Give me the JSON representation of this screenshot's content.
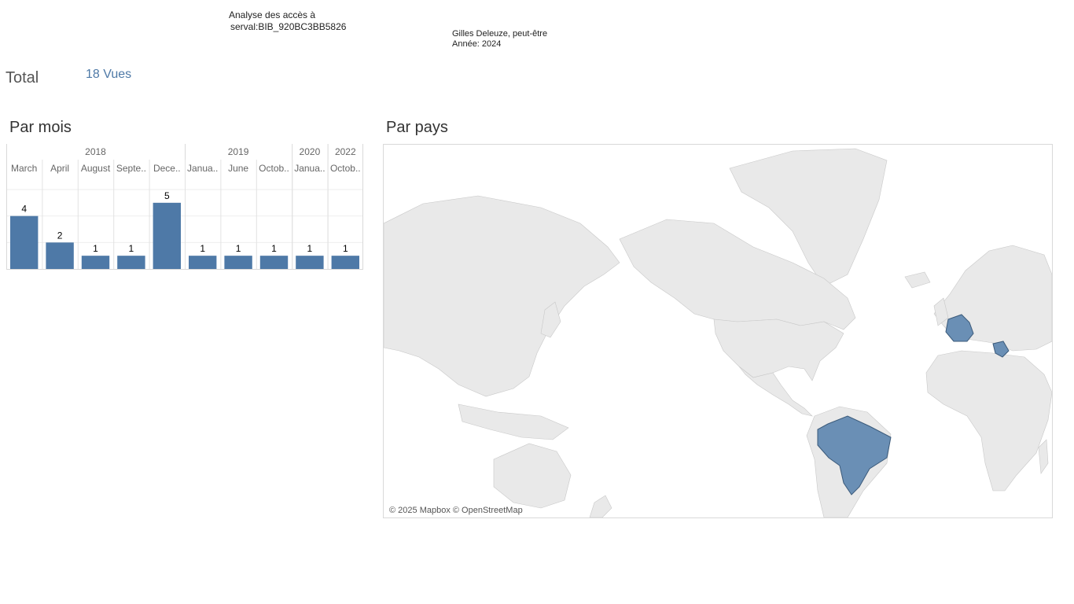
{
  "header": {
    "title_line1": "Analyse des accès à",
    "title_line2": "serval:BIB_920BC3BB5826",
    "author": "Gilles Deleuze, peut-être",
    "year": "Année: 2024"
  },
  "total": {
    "label": "Total",
    "value": "18 Vues"
  },
  "sections": {
    "by_month": "Par mois",
    "by_country": "Par pays"
  },
  "chart_data": {
    "type": "bar",
    "years": [
      {
        "label": "2018",
        "span": 5
      },
      {
        "label": "2019",
        "span": 3
      },
      {
        "label": "2020",
        "span": 1
      },
      {
        "label": "2022",
        "span": 1
      }
    ],
    "categories": [
      "March",
      "April",
      "August",
      "Septe..",
      "Dece..",
      "Janua..",
      "June",
      "Octob..",
      "Janua..",
      "Octob.."
    ],
    "values": [
      4,
      2,
      1,
      1,
      5,
      1,
      1,
      1,
      1,
      1
    ],
    "ylim": [
      0,
      6
    ],
    "bar_color": "#4e79a7"
  },
  "map": {
    "attribution": "© 2025 Mapbox © OpenStreetMap",
    "highlighted_countries": [
      "France",
      "Greece",
      "Brazil"
    ],
    "land_color": "#e8e8e8",
    "highlight_color": "#6a8fb5"
  }
}
